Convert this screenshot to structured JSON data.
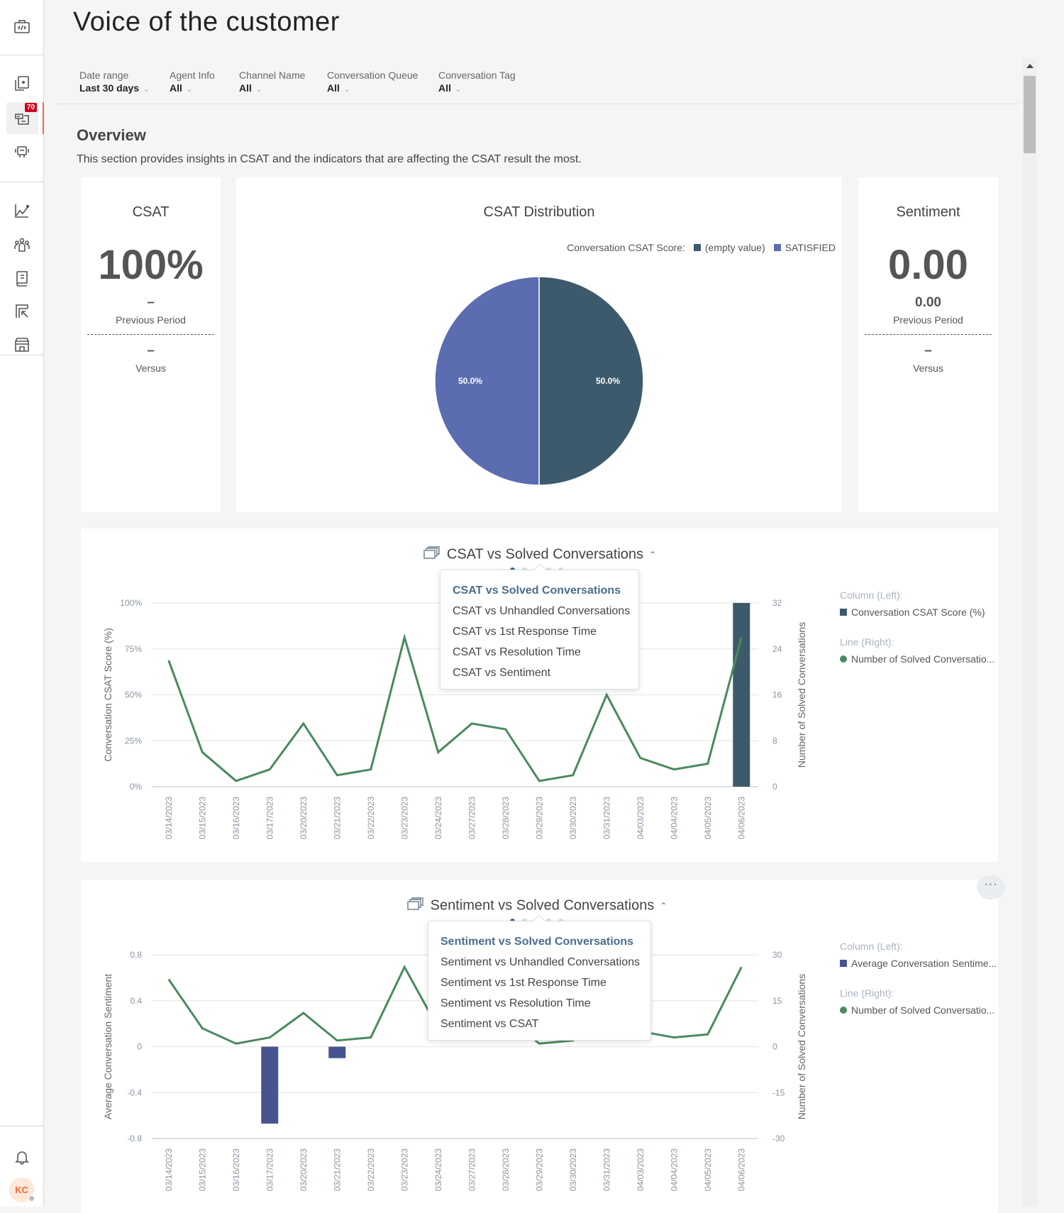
{
  "page": {
    "title": "Voice of the customer"
  },
  "sidebar": {
    "items": [
      {
        "name": "developer-icon"
      },
      {
        "name": "reports-icon"
      },
      {
        "name": "inbox-icon",
        "badge": "70",
        "active": true
      },
      {
        "name": "bot-icon"
      },
      {
        "name": "analytics-icon"
      },
      {
        "name": "team-icon"
      },
      {
        "name": "knowledge-icon"
      },
      {
        "name": "campaign-icon"
      },
      {
        "name": "store-icon"
      }
    ],
    "notifications_icon": "bell-icon",
    "user_initials": "KC"
  },
  "filters": [
    {
      "label": "Date range",
      "value": "Last 30 days"
    },
    {
      "label": "Agent Info",
      "value": "All"
    },
    {
      "label": "Channel Name",
      "value": "All"
    },
    {
      "label": "Conversation Queue",
      "value": "All"
    },
    {
      "label": "Conversation Tag",
      "value": "All"
    }
  ],
  "overview": {
    "title": "Overview",
    "description": "This section provides insights in CSAT and the indicators that are affecting the CSAT result the most."
  },
  "csat_card": {
    "title": "CSAT",
    "value": "100%",
    "previous": "–",
    "previous_label": "Previous Period",
    "versus": "–",
    "versus_label": "Versus"
  },
  "sentiment_card": {
    "title": "Sentiment",
    "value": "0.00",
    "previous": "0.00",
    "previous_label": "Previous Period",
    "versus": "–",
    "versus_label": "Versus"
  },
  "colors": {
    "dark": "#3d5a6c",
    "indigo": "#5b6db0",
    "bar2": "#46548f",
    "line": "#4a8a5e"
  },
  "chart_data": [
    {
      "type": "pie",
      "title": "CSAT Distribution",
      "legend_title": "Conversation CSAT Score:",
      "legend_position": "top-right",
      "slices": [
        {
          "label": "(empty value)",
          "value": 50.0,
          "display": "50.0%",
          "color": "#3d5a6c"
        },
        {
          "label": "SATISFIED",
          "value": 50.0,
          "display": "50.0%",
          "color": "#5b6db0"
        }
      ]
    },
    {
      "type": "bar+line",
      "title": "CSAT vs Solved Conversations",
      "menu": [
        "CSAT vs Solved Conversations",
        "CSAT vs Unhandled Conversations",
        "CSAT vs 1st Response Time",
        "CSAT vs Resolution Time",
        "CSAT vs Sentiment"
      ],
      "selected": 0,
      "ylabel_left": "Conversation CSAT Score (%)",
      "ylabel_right": "Number of Solved Conversations",
      "yticks_left": [
        "100%",
        "75%",
        "50%",
        "25%",
        "0%"
      ],
      "ylim_left": [
        0,
        100
      ],
      "yticks_right": [
        "32",
        "24",
        "16",
        "8",
        "0"
      ],
      "ylim_right": [
        0,
        32
      ],
      "categories": [
        "03/14/2023",
        "03/15/2023",
        "03/16/2023",
        "03/17/2023",
        "03/20/2023",
        "03/21/2023",
        "03/22/2023",
        "03/23/2023",
        "03/24/2023",
        "03/27/2023",
        "03/28/2023",
        "03/29/2023",
        "03/30/2023",
        "03/31/2023",
        "04/03/2023",
        "04/04/2023",
        "04/05/2023",
        "04/06/2023"
      ],
      "series": [
        {
          "name": "Conversation CSAT Score (%)",
          "kind": "column",
          "axis": "left",
          "color": "#3d5a6c",
          "values": [
            null,
            null,
            null,
            null,
            null,
            null,
            null,
            null,
            null,
            null,
            null,
            null,
            null,
            null,
            null,
            null,
            null,
            100
          ]
        },
        {
          "name": "Number of Solved Conversations",
          "kind": "line",
          "axis": "right",
          "color": "#4a8a5e",
          "values": [
            22,
            6,
            1,
            3,
            11,
            2,
            3,
            26,
            6,
            11,
            10,
            1,
            2,
            16,
            5,
            3,
            4,
            26
          ]
        }
      ],
      "legend": {
        "column_group": "Column (Left):",
        "column_label": "Conversation CSAT Score (%)",
        "line_group": "Line (Right):",
        "line_label": "Number of Solved Conversatio..."
      }
    },
    {
      "type": "bar+line",
      "title": "Sentiment vs Solved Conversations",
      "menu": [
        "Sentiment vs Solved Conversations",
        "Sentiment vs Unhandled Conversations",
        "Sentiment vs 1st Response Time",
        "Sentiment vs Resolution Time",
        "Sentiment vs CSAT"
      ],
      "selected": 0,
      "ylabel_left": "Average Conversation Sentiment",
      "ylabel_right": "Number of Solved Conversations",
      "yticks_left": [
        "0.8",
        "0.4",
        "0",
        "-0.4",
        "-0.8"
      ],
      "ylim_left": [
        -0.8,
        0.8
      ],
      "yticks_right": [
        "30",
        "15",
        "0",
        "-15",
        "-30"
      ],
      "ylim_right": [
        -30,
        30
      ],
      "categories": [
        "03/14/2023",
        "03/15/2023",
        "03/16/2023",
        "03/17/2023",
        "03/20/2023",
        "03/21/2023",
        "03/22/2023",
        "03/23/2023",
        "03/24/2023",
        "03/27/2023",
        "03/28/2023",
        "03/29/2023",
        "03/30/2023",
        "03/31/2023",
        "04/03/2023",
        "04/04/2023",
        "04/05/2023",
        "04/06/2023"
      ],
      "series": [
        {
          "name": "Average Conversation Sentiment",
          "kind": "column",
          "axis": "left",
          "color": "#46548f",
          "values": [
            null,
            null,
            null,
            -0.67,
            null,
            -0.1,
            null,
            null,
            null,
            null,
            null,
            null,
            null,
            null,
            null,
            null,
            null,
            null
          ]
        },
        {
          "name": "Number of Solved Conversations",
          "kind": "line",
          "axis": "right",
          "color": "#4a8a5e",
          "values": [
            22,
            6,
            1,
            3,
            11,
            2,
            3,
            26,
            6,
            11,
            10,
            1,
            2,
            16,
            5,
            3,
            4,
            26
          ]
        }
      ],
      "legend": {
        "column_group": "Column (Left):",
        "column_label": "Average Conversation Sentime...",
        "line_group": "Line (Right):",
        "line_label": "Number of Solved Conversatio..."
      }
    }
  ]
}
